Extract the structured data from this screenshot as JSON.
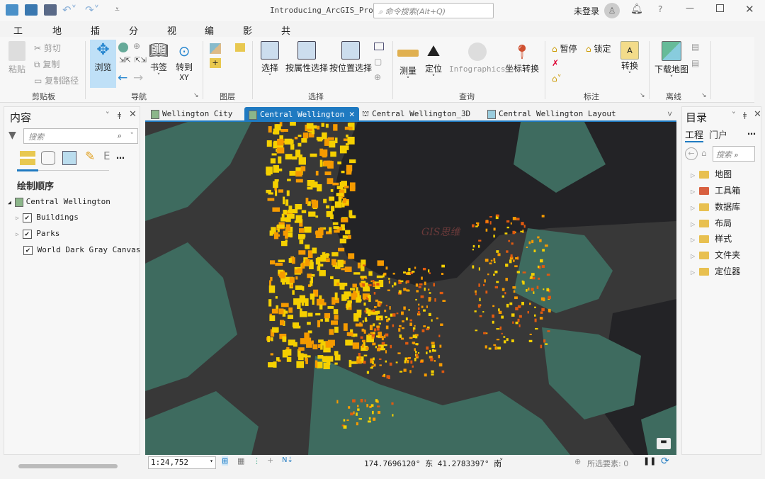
{
  "titlebar": {
    "title": "Introducing_ArcGIS_Pro",
    "search_placeholder": "命令搜索(Alt+Q)",
    "signin": "未登录",
    "help": "?"
  },
  "menu_tabs": [
    "工程",
    "地图",
    "插入",
    "分析",
    "视图",
    "编辑",
    "影像",
    "共享"
  ],
  "ribbon": {
    "clipboard": {
      "paste": "粘贴",
      "cut": "剪切",
      "copy": "复制",
      "copy_path": "复制路径",
      "group": "剪贴板"
    },
    "navigate": {
      "explore": "浏览",
      "bookmarks": "书签",
      "goto_1": "转到",
      "goto_2": "XY",
      "group": "导航"
    },
    "layer": {
      "group": "图层"
    },
    "selection": {
      "select": "选择",
      "by_attr": "按属性选择",
      "by_loc": "按位置选择",
      "group": "选择"
    },
    "inquiry": {
      "measure": "测量",
      "locate": "定位",
      "infographics": "Infographics",
      "coord": "坐标转换",
      "group": "查询"
    },
    "labeling": {
      "pause": "暂停",
      "lock": "锁定",
      "convert": "转换",
      "group": "标注"
    },
    "offline": {
      "download": "下载地图",
      "group": "离线"
    }
  },
  "contents": {
    "title": "内容",
    "search_placeholder": "搜索",
    "draw_order": "绘制顺序",
    "map_name": "Central Wellington",
    "layers": [
      {
        "name": "Buildings",
        "checked": true
      },
      {
        "name": "Parks",
        "checked": true
      },
      {
        "name": "World Dark Gray Canvas Ba",
        "checked": true
      }
    ]
  },
  "map_tabs": [
    {
      "label": "Wellington City",
      "active": false
    },
    {
      "label": "Central Wellington",
      "active": true
    },
    {
      "label": "Central Wellington_3D",
      "active": false
    },
    {
      "label": "Central Wellington Layout",
      "active": false
    }
  ],
  "map": {
    "watermark": "GIS思维",
    "colors": {
      "land": "#3a3a3a",
      "water": "#232326",
      "park": "#3e6b5f",
      "b1": "#f5d000",
      "b2": "#f59a00",
      "b3": "#e05a10"
    }
  },
  "status": {
    "scale": "1:24,752",
    "coords": "174.7696120° 东 41.2783397° 南",
    "selected": "所选要素: 0"
  },
  "catalog": {
    "title": "目录",
    "tabs": [
      "工程",
      "门户"
    ],
    "search_placeholder": "搜索",
    "items": [
      "地图",
      "工具箱",
      "数据库",
      "布局",
      "样式",
      "文件夹",
      "定位器"
    ]
  }
}
